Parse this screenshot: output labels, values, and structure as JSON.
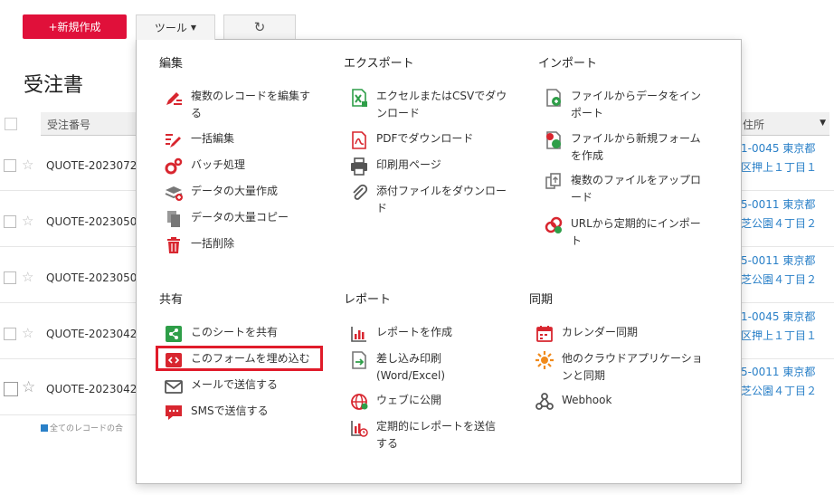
{
  "toolbar": {
    "new_label": "+新規作成",
    "tools_label": "ツール",
    "refresh_icon": "refresh-icon"
  },
  "page": {
    "title": "受注書"
  },
  "table": {
    "column_id": "受注番号",
    "column_addr": "住所",
    "rows": [
      {
        "id": "QUOTE-2023072",
        "addr1": "1-0045 東京都",
        "addr2": "区押上１丁目１"
      },
      {
        "id": "QUOTE-2023050",
        "addr1": "5-0011 東京都",
        "addr2": "芝公園４丁目２"
      },
      {
        "id": "QUOTE-2023050",
        "addr1": "5-0011 東京都",
        "addr2": "芝公園４丁目２"
      },
      {
        "id": "QUOTE-2023042",
        "addr1": "1-0045 東京都",
        "addr2": "区押上１丁目１"
      },
      {
        "id": "QUOTE-2023042",
        "addr1": "5-0011 東京都",
        "addr2": "芝公園４丁目２"
      }
    ],
    "footer": "全てのレコードの合"
  },
  "menu": {
    "edit": {
      "title": "編集",
      "items": [
        "複数のレコードを編集す\nる",
        "一括編集",
        "バッチ処理",
        "データの大量作成",
        "データの大量コピー",
        "一括削除"
      ]
    },
    "export": {
      "title": "エクスポート",
      "items": [
        "エクセルまたはCSVでダウ\nンロード",
        "PDFでダウンロード",
        "印刷用ページ",
        "添付ファイルをダウンロー\nド"
      ]
    },
    "import": {
      "title": "インポート",
      "items": [
        "ファイルからデータをイン\nポート",
        "ファイルから新規フォーム\nを作成",
        "複数のファイルをアップロ\nード",
        "URLから定期的にインポー\nト"
      ]
    },
    "share": {
      "title": "共有",
      "items": [
        "このシートを共有",
        "このフォームを埋め込む",
        "メールで送信する",
        "SMSで送信する"
      ]
    },
    "report": {
      "title": "レポート",
      "items": [
        "レポートを作成",
        "差し込み印刷\n(Word/Excel)",
        "ウェブに公開",
        "定期的にレポートを送信\nする"
      ]
    },
    "sync": {
      "title": "同期",
      "items": [
        "カレンダー同期",
        "他のクラウドアプリケーショ\nンと同期",
        "Webhook"
      ]
    }
  },
  "colors": {
    "brand_red": "#e0103a",
    "link_blue": "#2a80c8",
    "icon_green": "#2e9e48",
    "icon_red": "#d8262f",
    "icon_orange": "#f08a1c",
    "highlight": "#e01b2a"
  }
}
